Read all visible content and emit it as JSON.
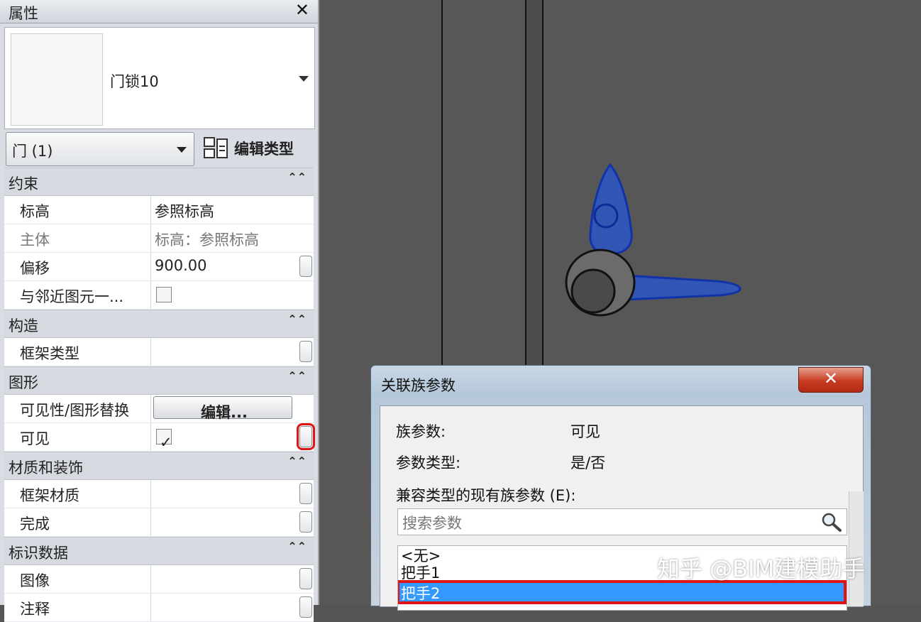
{
  "panel": {
    "title": "属性",
    "close_glyph": "✕",
    "type_name": "门锁10",
    "instance_filter": "门 (1)",
    "edit_type_label": "编辑类型"
  },
  "groups": {
    "constraints": "约束",
    "construction": "构造",
    "graphics": "图形",
    "materials": "材质和装饰",
    "identity": "标识数据",
    "collapse_glyph": "⌃⌃"
  },
  "rows": {
    "level": {
      "name": "标高",
      "value": "参照标高"
    },
    "host": {
      "name": "主体",
      "value": "标高：参照标高"
    },
    "offset": {
      "name": "偏移",
      "value": "900.00"
    },
    "move_with": {
      "name": "与邻近图元一..."
    },
    "frame_type": {
      "name": "框架类型"
    },
    "vis_override": {
      "name": "可见性/图形替换",
      "button": "编辑..."
    },
    "visible": {
      "name": "可见",
      "checked": true
    },
    "frame_material": {
      "name": "框架材质"
    },
    "finish": {
      "name": "完成"
    },
    "image": {
      "name": "图像"
    },
    "comments": {
      "name": "注释"
    }
  },
  "dialog": {
    "title": "关联族参数",
    "close_glyph": "✕",
    "family_param_label": "族参数:",
    "family_param_value": "可见",
    "param_type_label": "参数类型:",
    "param_type_value": "是/否",
    "compatible_label": "兼容类型的现有族参数 (E):",
    "search_placeholder": "搜索参数",
    "params": [
      "<无>",
      "把手1",
      "把手2"
    ],
    "selected_param": "把手2"
  },
  "watermark": "知乎 @BIM建模助手",
  "colors": {
    "selection": "#3399ff",
    "highlight_box": "#e01414",
    "handle_blue": "#1a4fd6"
  }
}
